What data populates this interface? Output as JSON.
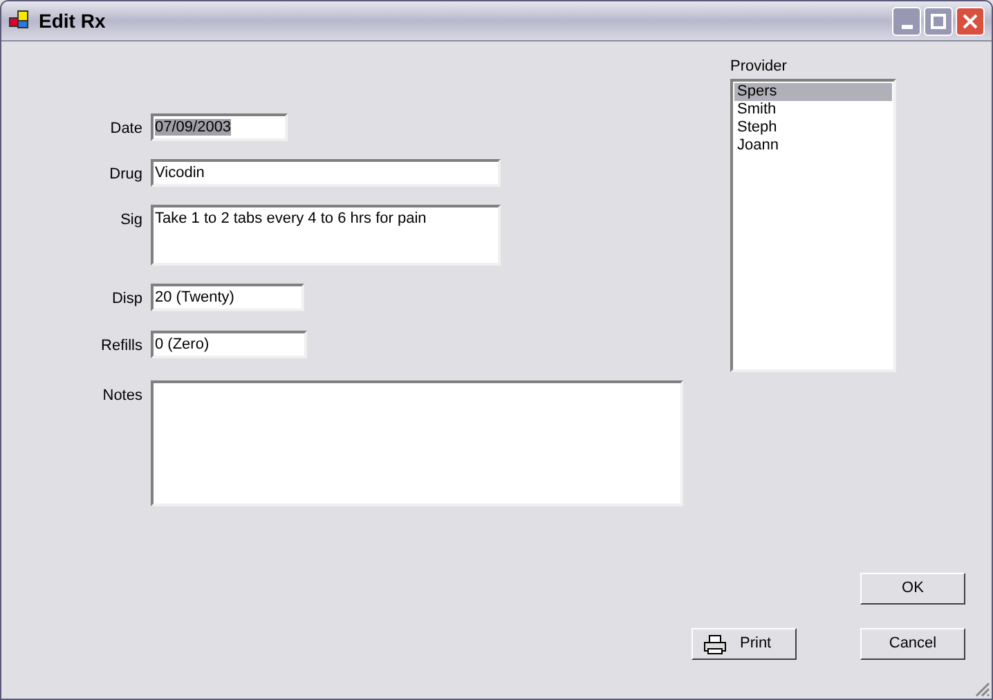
{
  "window": {
    "title": "Edit Rx"
  },
  "fields": [
    {
      "label": "Date",
      "value": "07/09/2003",
      "text_selected": true,
      "kind": "line"
    },
    {
      "label": "Drug",
      "value": "Vicodin",
      "kind": "line"
    },
    {
      "label": "Sig",
      "value": "Take 1 to 2 tabs every 4 to 6 hrs for pain",
      "kind": "memo"
    },
    {
      "label": "Disp",
      "value": "20 (Twenty)",
      "kind": "line"
    },
    {
      "label": "Refills",
      "value": "0 (Zero)",
      "kind": "line"
    },
    {
      "label": "Notes",
      "kind": "memo"
    }
  ],
  "provider": {
    "label": "Provider",
    "items": [
      {
        "name": "Spers",
        "selected": true
      },
      {
        "name": "Smith",
        "selected": false
      },
      {
        "name": "Steph",
        "selected": false
      },
      {
        "name": "Joann",
        "selected": false
      }
    ]
  },
  "buttons": {
    "print": "Print",
    "ok": "OK",
    "cancel": "Cancel"
  }
}
